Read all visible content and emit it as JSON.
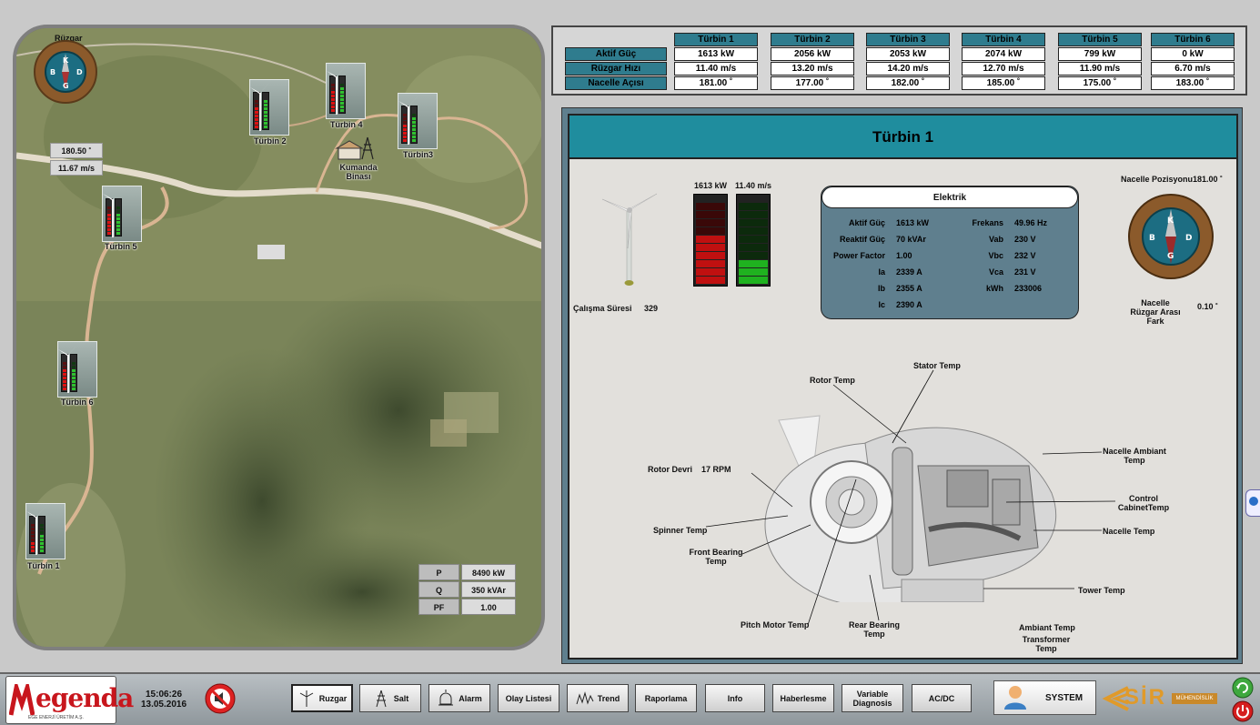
{
  "map": {
    "compass": {
      "title": "Rüzgar",
      "labels": {
        "n": "K",
        "s": "G",
        "e": "D",
        "w": "B"
      },
      "ticks": [
        "360",
        "45",
        "90",
        "135",
        "180",
        "225",
        "270",
        "315"
      ],
      "direction": "180.50 ˚",
      "speed": "11.67 m/s"
    },
    "turbines": [
      {
        "label": "Türbin 1",
        "red": 3,
        "green": 5
      },
      {
        "label": "Türbin 2",
        "red": 6,
        "green": 8
      },
      {
        "label": "Türbin 4",
        "red": 6,
        "green": 7
      },
      {
        "label": "Türbin3",
        "red": 5,
        "green": 7
      },
      {
        "label": "Türbin 5",
        "red": 6,
        "green": 6
      },
      {
        "label": "Türbin 6",
        "red": 6,
        "green": 6
      }
    ],
    "control_building": "Kumanda Binası",
    "power": [
      {
        "k": "P",
        "v": "8490 kW"
      },
      {
        "k": "Q",
        "v": "350 kVAr"
      },
      {
        "k": "PF",
        "v": "1.00"
      }
    ]
  },
  "table": {
    "rows": [
      "Aktif Güç",
      "Rüzgar Hızı",
      "Nacelle Açısı"
    ],
    "turbines": [
      {
        "name": "Türbin 1",
        "vals": [
          "1613 kW",
          "11.40 m/s",
          "181.00 ˚"
        ]
      },
      {
        "name": "Türbin 2",
        "vals": [
          "2056 kW",
          "13.20 m/s",
          "177.00 ˚"
        ]
      },
      {
        "name": "Türbin 3",
        "vals": [
          "2053 kW",
          "14.20 m/s",
          "182.00 ˚"
        ]
      },
      {
        "name": "Türbin 4",
        "vals": [
          "2074 kW",
          "12.70 m/s",
          "185.00 ˚"
        ]
      },
      {
        "name": "Türbin 5",
        "vals": [
          "799 kW",
          "11.90 m/s",
          "175.00 ˚"
        ]
      },
      {
        "name": "Türbin 6",
        "vals": [
          "0 kW",
          "6.70 m/s",
          "183.00 ˚"
        ]
      }
    ]
  },
  "detail": {
    "title": "Türbin 1",
    "runtime_label": "Çalışma Süresi",
    "runtime_value": "329",
    "power_label": "1613 kW",
    "wind_label": "11.40 m/s",
    "power_level": 0.6,
    "wind_level": 0.3,
    "nacelle_pos_label": "Nacelle Pozisyonu",
    "nacelle_pos_value": "181.00 ˚",
    "nacelle_diff_label": "Nacelle Rüzgar Arası Fark",
    "nacelle_diff_value": "0.10 ˚",
    "elektrik": {
      "title": "Elektrik",
      "left": [
        {
          "k": "Aktif Güç",
          "v": "1613 kW"
        },
        {
          "k": "Reaktif Güç",
          "v": "70 kVAr"
        },
        {
          "k": "Power Factor",
          "v": "1.00"
        },
        {
          "k": "Ia",
          "v": "2339 A"
        },
        {
          "k": "Ib",
          "v": "2355 A"
        },
        {
          "k": "Ic",
          "v": "2390 A"
        }
      ],
      "right": [
        {
          "k": "Frekans",
          "v": "49.96 Hz"
        },
        {
          "k": "Vab",
          "v": "230 V"
        },
        {
          "k": "Vbc",
          "v": "232 V"
        },
        {
          "k": "Vca",
          "v": "231 V"
        },
        {
          "k": "kWh",
          "v": "233006"
        }
      ]
    },
    "labels": {
      "stator": "Stator Temp",
      "rotor": "Rotor Temp",
      "nacelle_ambiant": "Nacelle Ambiant Temp",
      "rotor_devri": "Rotor Devri",
      "rotor_devri_v": "17 RPM",
      "control": "Control CabinetTemp",
      "spinner": "Spinner Temp",
      "nacelle": "Nacelle Temp",
      "front_bearing": "Front Bearing Temp",
      "tower": "Tower Temp",
      "pitch": "Pitch Motor Temp",
      "rear_bearing": "Rear Bearing Temp",
      "ambiant": "Ambiant Temp",
      "transformer": "Transformer Temp"
    }
  },
  "bottom": {
    "logo": "egenda",
    "logo_sub": "EGE ENERJİ ÜRETİM A.Ş.",
    "time": "15:06:26",
    "date": "13.05.2016",
    "buttons": [
      "Ruzgar",
      "Salt",
      "Alarm",
      "Olay Listesi",
      "Trend",
      "Raporlama",
      "Info",
      "Haberlesme",
      "Variable Diagnosis",
      "AC/DC"
    ],
    "system": "SYSTEM",
    "brand": "SİR",
    "brand_sub": "MÜHENDİSLİK"
  }
}
